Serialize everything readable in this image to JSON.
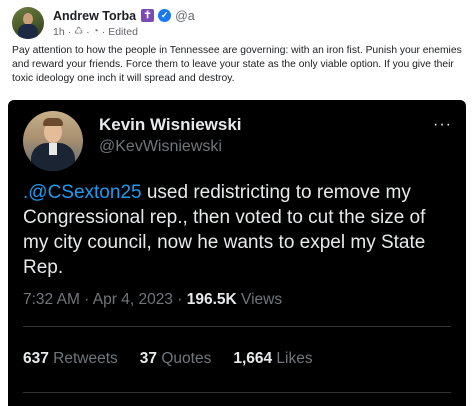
{
  "post": {
    "author": "Andrew Torba",
    "handle": "@a",
    "badge_icon": "cross-icon",
    "time": "1h",
    "edited": "Edited",
    "text": "Pay attention to how the people in Tennessee are governing: with an iron fist. Punish your enemies and reward your friends. Force them to leave your state as the only viable option. If you give their toxic ideology one inch it will spread and destroy."
  },
  "quoted_tweet": {
    "name": "Kevin Wisniewski",
    "handle": "@KevWisniewski",
    "more": "···",
    "mention": ".@CSexton25",
    "text_rest": " used redistricting to remove my Congressional rep., then voted to cut the size  of my city council, now he wants to expel my State Rep.",
    "timestamp": "7:32 AM · Apr 4, 2023 · ",
    "views_count": "196.5K",
    "views_label": " Views",
    "stats": {
      "retweets_count": "637",
      "retweets_label": " Retweets",
      "quotes_count": "37",
      "quotes_label": " Quotes",
      "likes_count": "1,664",
      "likes_label": " Likes"
    }
  },
  "colors": {
    "link_blue": "#1d9bf0",
    "tweet_bg": "#000000",
    "verified_blue": "#1877f2",
    "badge_purple": "#7b4bb3"
  }
}
